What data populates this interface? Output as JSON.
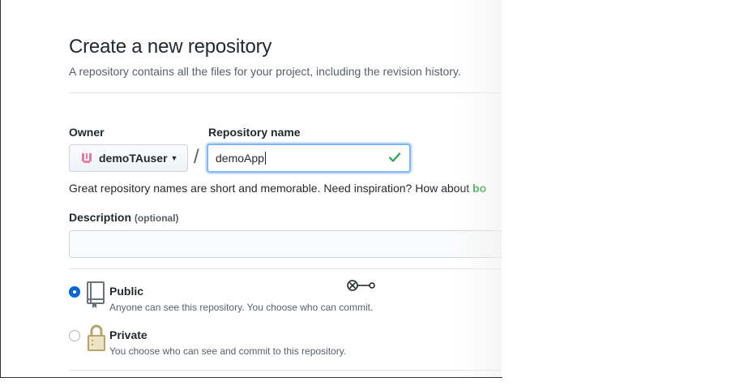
{
  "page": {
    "title": "Create a new repository",
    "subtitle": "A repository contains all the files for your project, including the revision history."
  },
  "form": {
    "owner_label": "Owner",
    "owner_value": "demoTAuser",
    "separator": "/",
    "repo_name_label": "Repository name",
    "repo_name_value": "demoApp",
    "hint_text": "Great repository names are short and memorable. Need inspiration? How about ",
    "hint_suggestion": "bo",
    "description_label": "Description",
    "description_optional": "(optional)",
    "description_value": ""
  },
  "visibility": {
    "options": [
      {
        "title": "Public",
        "description": "Anyone can see this repository. You choose who can commit.",
        "selected": true
      },
      {
        "title": "Private",
        "description": "You choose who can see and commit to this repository.",
        "selected": false
      }
    ]
  },
  "colors": {
    "accent": "#0366d6",
    "success": "#28a745",
    "input_focus": "#79b8ff",
    "avatar": "#e37ba0",
    "lock": "#b9a46e"
  },
  "icons": {
    "owner_avatar": "identicon-avatar",
    "valid": "check-icon",
    "public": "repo-book-icon",
    "private": "lock-icon",
    "cursor": "drag-cursor-icon"
  }
}
